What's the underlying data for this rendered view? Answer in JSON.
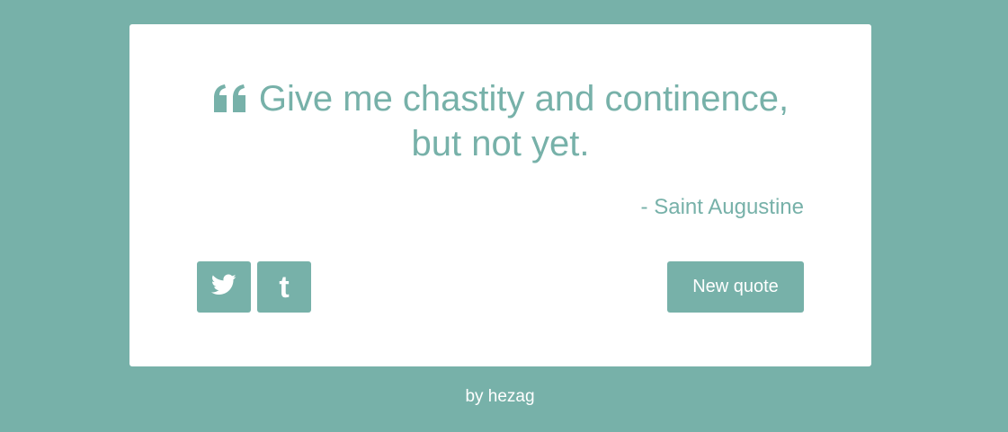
{
  "quote": {
    "icon": "quote-left-icon",
    "text": "Give me chastity and continence, but not yet."
  },
  "author": "- Saint Augustine",
  "buttons": {
    "twitter_icon": "twitter-icon",
    "tumblr_icon": "tumblr-icon",
    "tumblr_glyph": "t",
    "new_quote": "New quote"
  },
  "footer": "by hezag",
  "colors": {
    "background": "#77b1a9",
    "card": "#ffffff",
    "accent": "#77b1a9",
    "button_text": "#ffffff"
  }
}
